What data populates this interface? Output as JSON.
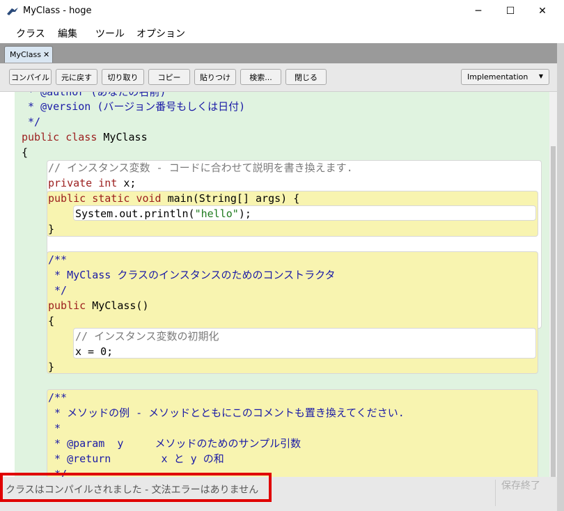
{
  "window": {
    "title": "MyClass - hoge",
    "minimize_glyph": "─",
    "maximize_glyph": "☐",
    "close_glyph": "✕"
  },
  "menu": [
    "クラス",
    "編集",
    "ツール",
    "オプション"
  ],
  "tab": {
    "label": "MyClass",
    "close_glyph": "✕"
  },
  "toolbar": {
    "buttons": [
      "コンパイル",
      "元に戻す",
      "切り取り",
      "コピー",
      "貼りつけ",
      "検索...",
      "閉じる"
    ],
    "view_select": "Implementation"
  },
  "code": {
    "author_line": " * @author (あなたの名前)",
    "version_line": " * @version (バージョン番号もしくは日付)",
    "class_comment_end": " */",
    "class_decl_kw1": "public",
    "class_decl_kw2": "class",
    "class_name": "MyClass",
    "open_brace": "{",
    "field_comment": "// インスタンス変数 - コードに合わせて説明を書き換えます.",
    "field_kw1": "private",
    "field_kw2": "int",
    "field_rest": "x;",
    "main_kw1": "public",
    "main_kw2": "static",
    "main_kw3": "void",
    "main_rest": "main(String[] args) {",
    "println_pre": "System.out.println(",
    "println_str": "\"hello\"",
    "println_post": ");",
    "main_close": "}",
    "ctor_doc_start": "/**",
    "ctor_doc_line": " * MyClass クラスのインスタンスのためのコンストラクタ",
    "ctor_doc_end": " */",
    "ctor_kw": "public",
    "ctor_rest": "MyClass()",
    "ctor_open": "{",
    "ctor_comment": "// インスタンス変数の初期化",
    "ctor_body": "x = 0;",
    "ctor_close": "}",
    "method_doc_start": "/**",
    "method_doc_line1": " * メソッドの例 - メソッドとともにこのコメントも置き換えてください.",
    "method_doc_line2": " *",
    "method_doc_param": " * @param  y     メソッドのためのサンプル引数",
    "method_doc_return": " * @return        x と y の和",
    "method_doc_end": " */"
  },
  "status": {
    "message": "クラスはコンパイルされました - 文法エラーはありません",
    "save_state": "保存終了"
  },
  "colors": {
    "keyword": "#9b1d1d",
    "comment": "#1a1aa6",
    "string": "#1e7a1e",
    "class_bg": "#e0f3e0",
    "method_bg": "#f8f4b0",
    "highlight_box": "#e00000"
  }
}
